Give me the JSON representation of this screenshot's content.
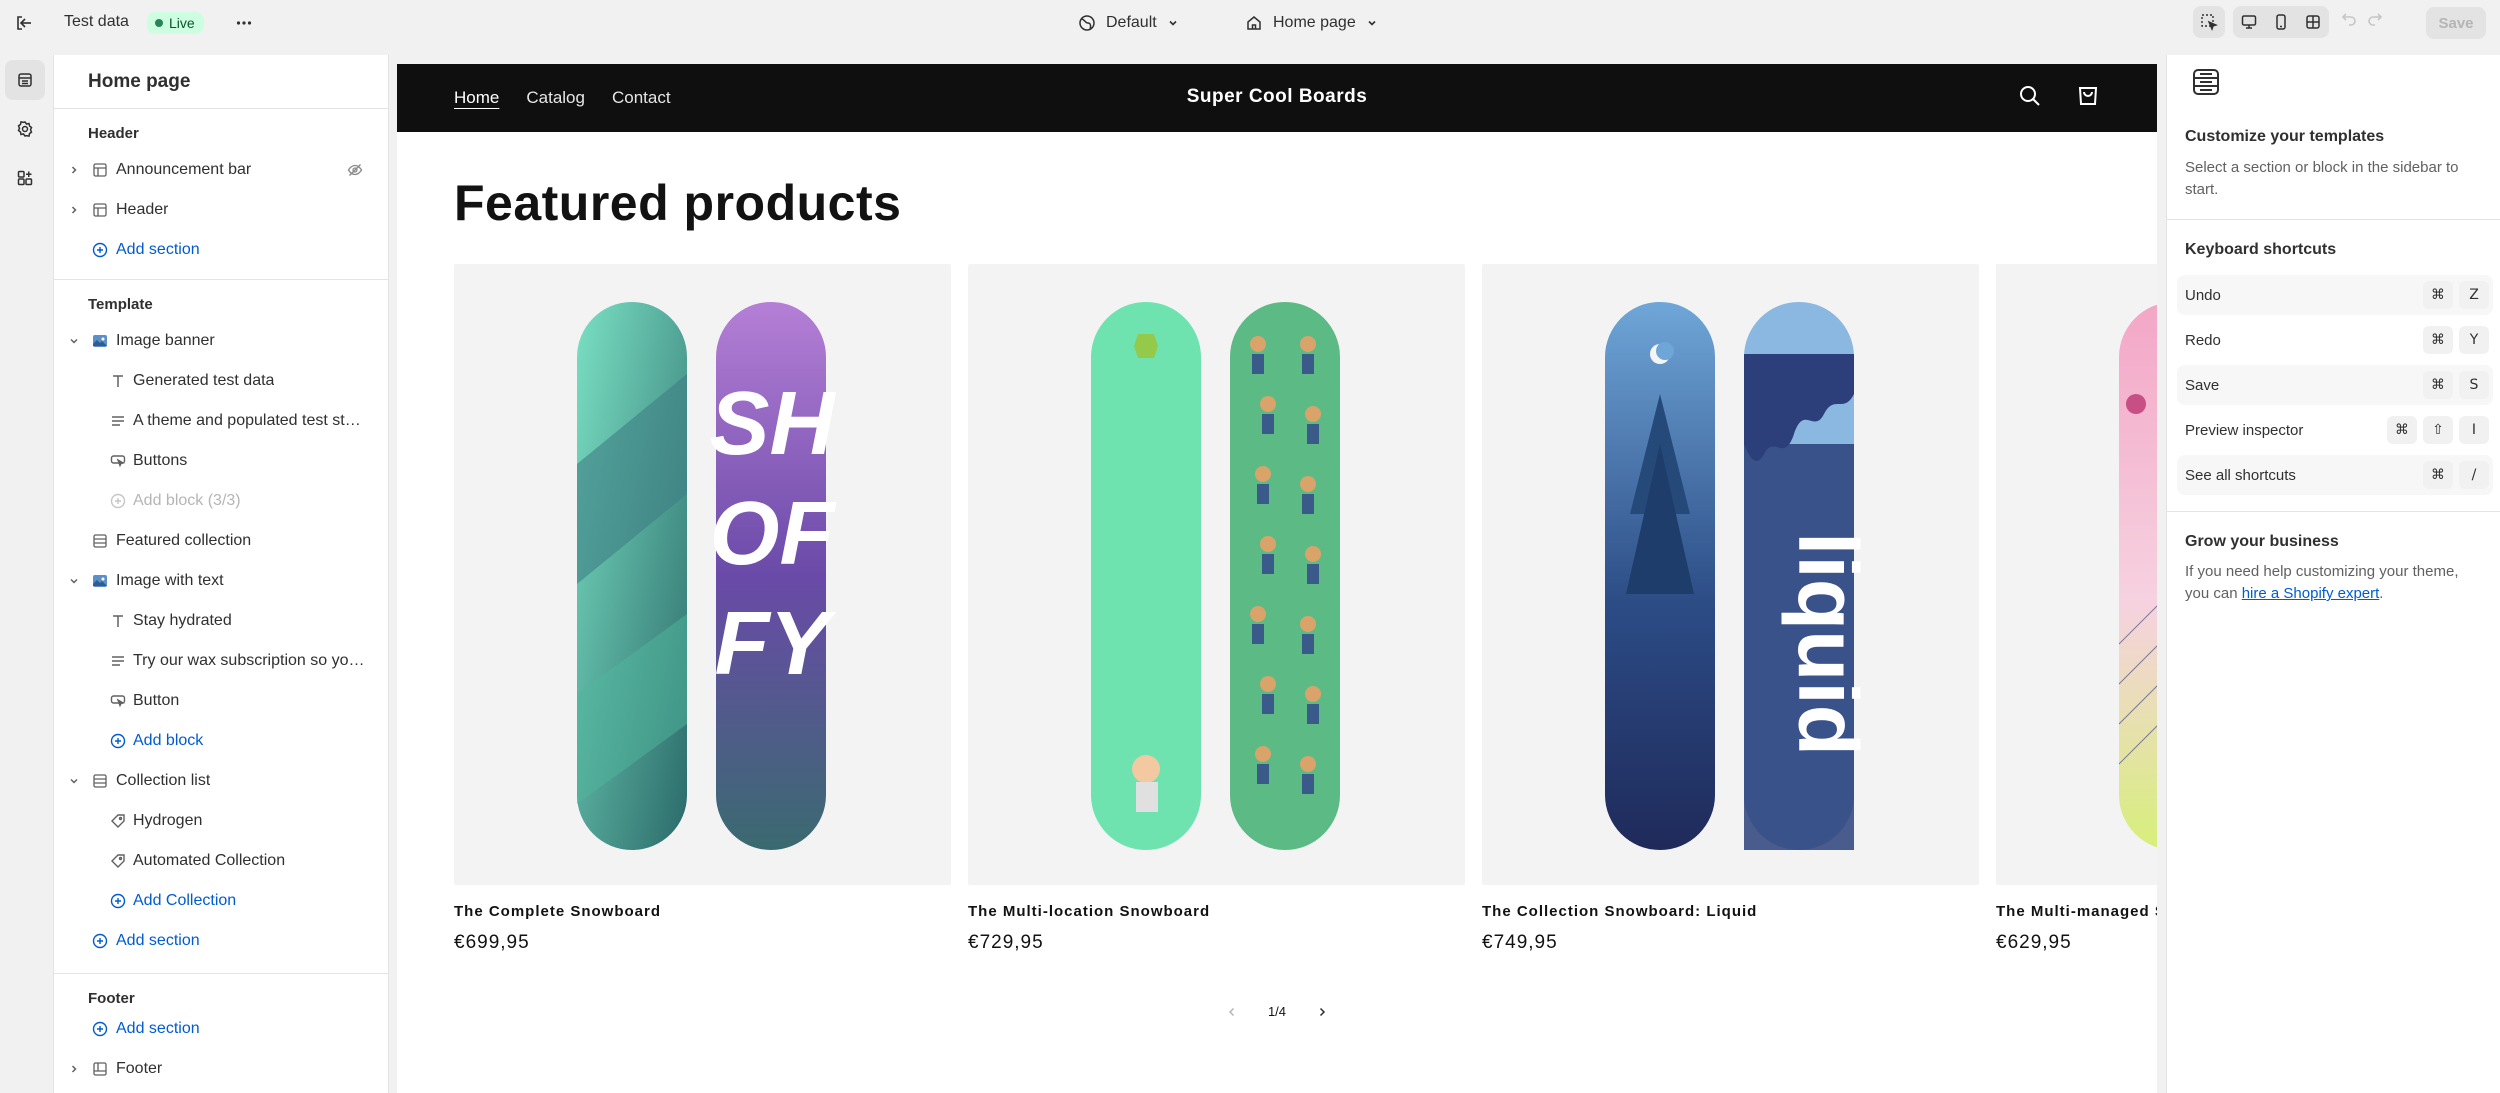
{
  "topbar": {
    "store_name": "Test data",
    "status_badge": "Live",
    "theme_selector": "Default",
    "page_selector": "Home page",
    "save_label": "Save"
  },
  "sidebar": {
    "title": "Home page",
    "groups": {
      "header": "Header",
      "template": "Template",
      "footer": "Footer"
    },
    "header_items": [
      "Announcement bar",
      "Header"
    ],
    "add_section": "Add section",
    "template_items": {
      "image_banner": "Image banner",
      "image_banner_blocks": [
        "Generated test data",
        "A theme and populated test store...",
        "Buttons"
      ],
      "add_block_limit": "Add block (3/3)",
      "featured_collection": "Featured collection",
      "image_with_text": "Image with text",
      "image_with_text_blocks": [
        "Stay hydrated",
        "Try our wax subscription so you ...",
        "Button"
      ],
      "add_block": "Add block",
      "collection_list": "Collection list",
      "collection_list_blocks": [
        "Hydrogen",
        "Automated Collection"
      ],
      "add_collection": "Add Collection"
    },
    "footer_items": [
      "Footer"
    ]
  },
  "preview": {
    "nav_links": [
      "Home",
      "Catalog",
      "Contact"
    ],
    "brand": "Super Cool Boards",
    "section_title": "Featured products",
    "products": [
      {
        "title": "The Complete Snowboard",
        "price": "€699,95"
      },
      {
        "title": "The Multi-location Snowboard",
        "price": "€729,95"
      },
      {
        "title": "The Collection Snowboard: Liquid",
        "price": "€749,95"
      },
      {
        "title": "The Multi-managed Snowboard",
        "price": "€629,95"
      }
    ],
    "pagination": "1/4"
  },
  "right_panel": {
    "customize_title": "Customize your templates",
    "customize_text": "Select a section or block in the sidebar to start.",
    "shortcuts_title": "Keyboard shortcuts",
    "shortcuts": [
      {
        "label": "Undo",
        "keys": [
          "⌘",
          "Z"
        ]
      },
      {
        "label": "Redo",
        "keys": [
          "⌘",
          "Y"
        ]
      },
      {
        "label": "Save",
        "keys": [
          "⌘",
          "S"
        ]
      },
      {
        "label": "Preview inspector",
        "keys": [
          "⌘",
          "⇧",
          "I"
        ]
      },
      {
        "label": "See all shortcuts",
        "keys": [
          "⌘",
          "/"
        ]
      }
    ],
    "grow_title": "Grow your business",
    "grow_text_before": "If you need help customizing your theme, you can",
    "grow_link": "hire a Shopify expert",
    "grow_text_after": "."
  },
  "colors": {
    "accent_link": "#005bd3",
    "live_badge_bg": "#cdfee1",
    "storefront_nav_bg": "#0f0f0f"
  }
}
